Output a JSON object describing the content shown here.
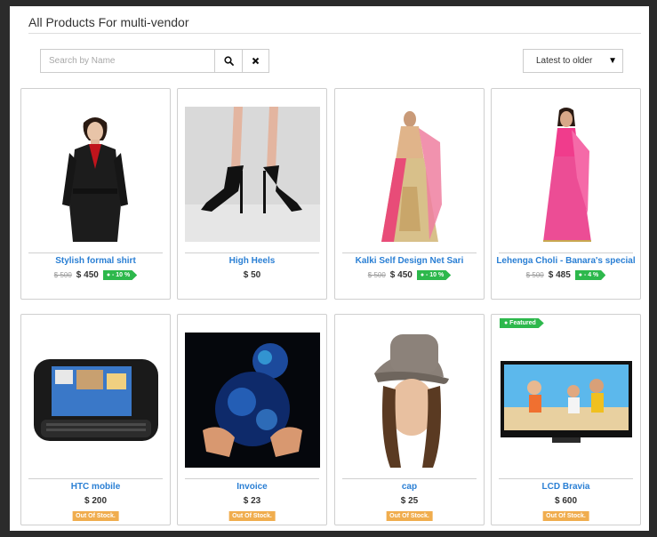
{
  "page": {
    "title": "All Products For multi-vendor"
  },
  "search": {
    "placeholder": "Search by Name",
    "search_icon": "search-icon",
    "clear_icon": "close-icon"
  },
  "sort": {
    "selected": "Latest to older",
    "arrow": "▼"
  },
  "colors": {
    "link": "#2a7fd4",
    "discount": "#2db84c",
    "out_of_stock": "#f0ad4e"
  },
  "products": [
    {
      "name": "Stylish formal shirt",
      "old_price": "$ 500",
      "price": "$ 450",
      "discount": "● - 10 %"
    },
    {
      "name": "High Heels",
      "price": "$ 50"
    },
    {
      "name": "Kalki Self Design Net Sari",
      "old_price": "$ 500",
      "price": "$ 450",
      "discount": "● - 10 %"
    },
    {
      "name": "Lehenga Choli - Banara's special",
      "old_price": "$ 500",
      "price": "$ 485",
      "discount": "● - 4 %"
    },
    {
      "name": "HTC mobile",
      "price": "$ 200",
      "stock": "Out Of Stock."
    },
    {
      "name": "Invoice",
      "price": "$ 23",
      "stock": "Out Of Stock."
    },
    {
      "name": "cap",
      "price": "$ 25",
      "stock": "Out Of Stock."
    },
    {
      "name": "LCD Bravia",
      "price": "$ 600",
      "stock": "Out Of Stock.",
      "badge": "● Featured"
    }
  ]
}
